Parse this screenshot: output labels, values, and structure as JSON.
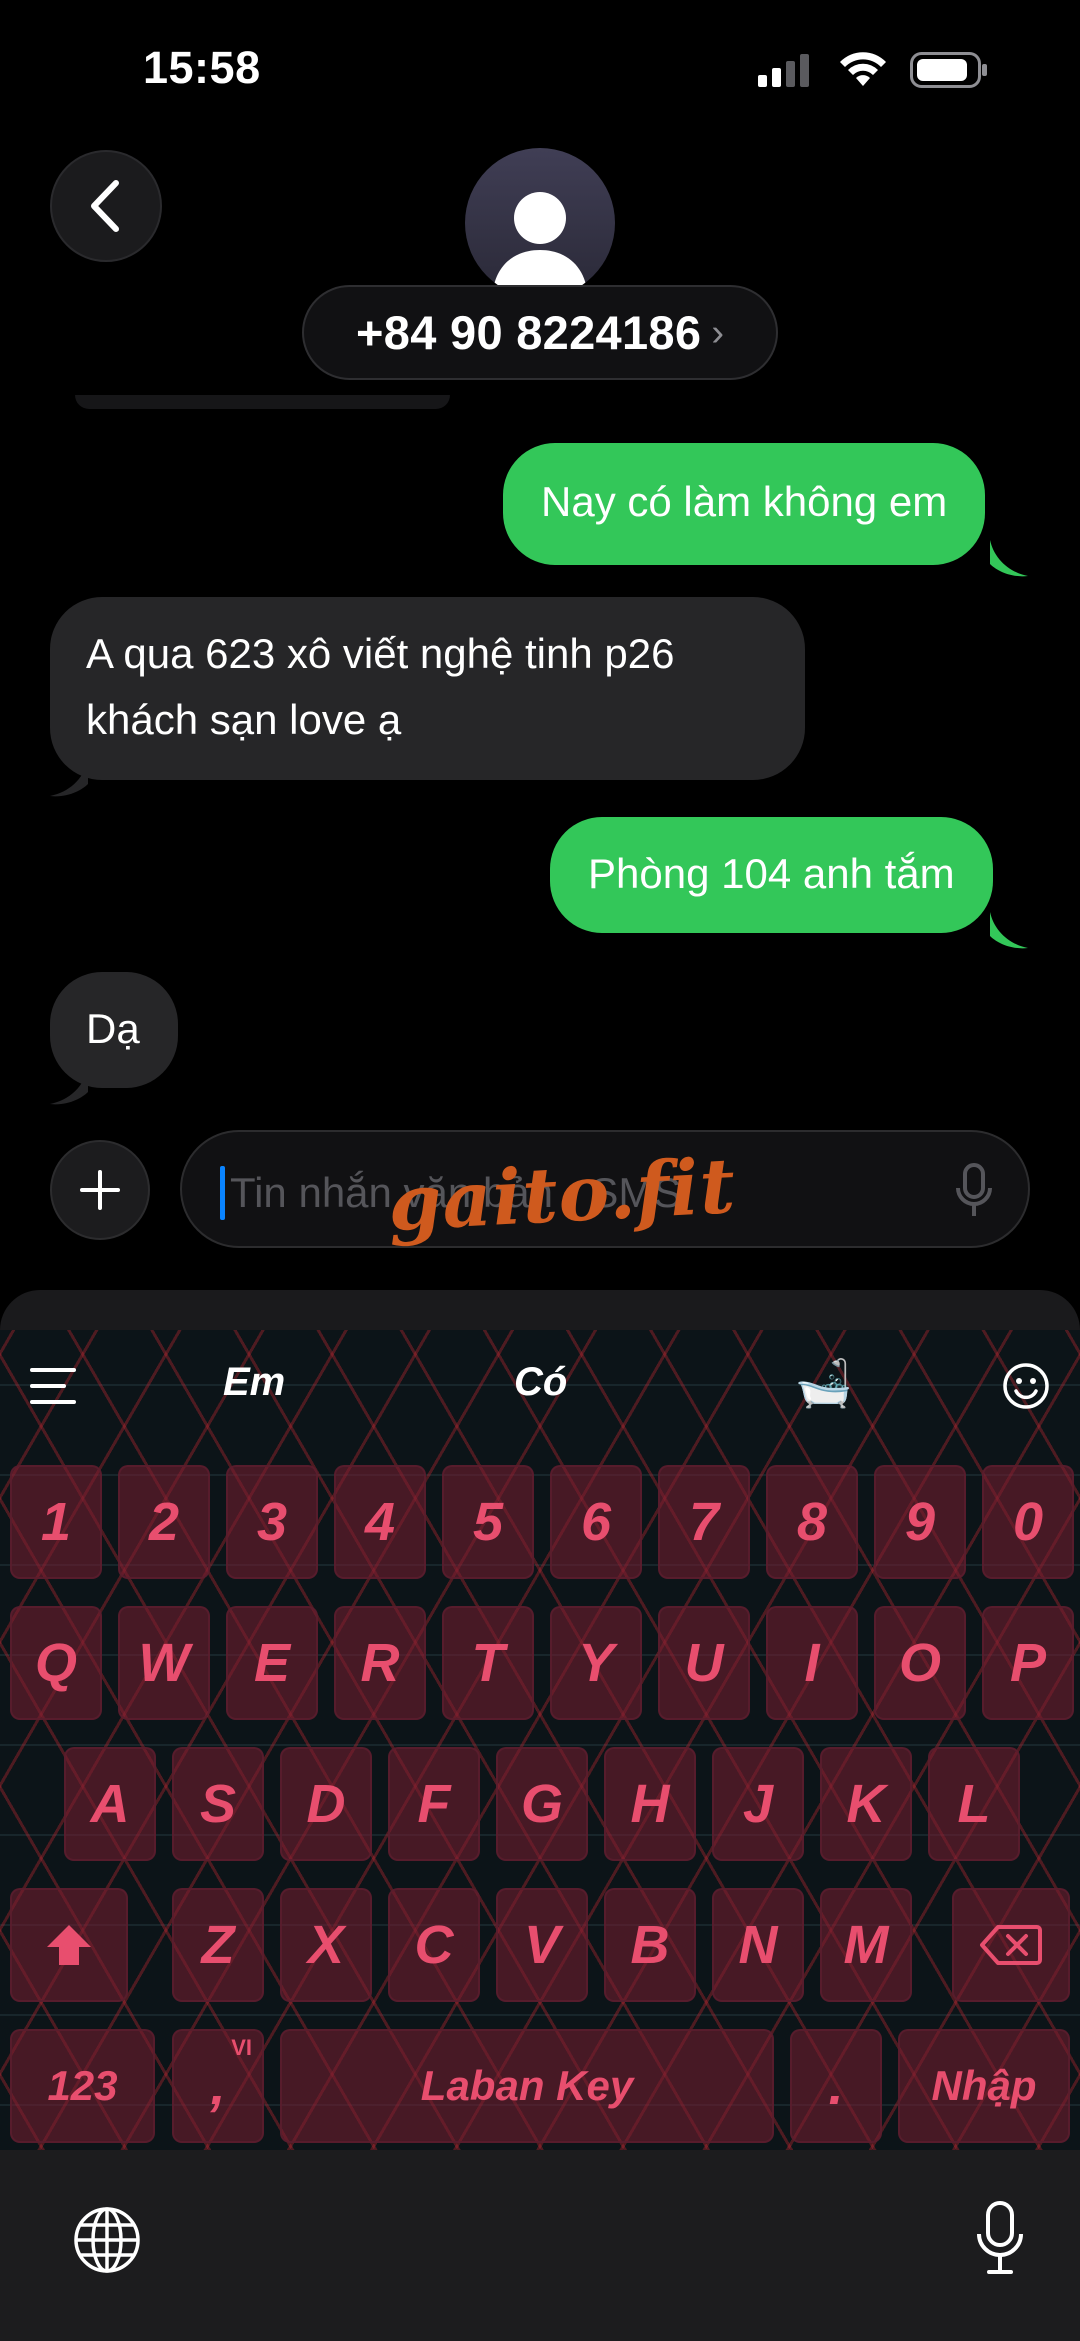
{
  "status_bar": {
    "time": "15:58"
  },
  "header": {
    "contact_number": "+84 90 8224186",
    "chevron": "›"
  },
  "messages": [
    {
      "type": "sent",
      "text": "Nay có làm không em"
    },
    {
      "type": "received",
      "line1": "A qua 623 xô viết nghệ tinh p26",
      "line2": "khách sạn love ạ"
    },
    {
      "type": "sent",
      "text": "Phòng 104 anh tắm"
    },
    {
      "type": "received",
      "text": "Dạ"
    }
  ],
  "input": {
    "placeholder": "Tin nhắn văn bản · SMS",
    "watermark": "gaito.fit"
  },
  "keyboard": {
    "suggestions": [
      "Em",
      "Có",
      "🛁"
    ],
    "row_numbers": [
      "1",
      "2",
      "3",
      "4",
      "5",
      "6",
      "7",
      "8",
      "9",
      "0"
    ],
    "row_q": [
      "Q",
      "W",
      "E",
      "R",
      "T",
      "Y",
      "U",
      "I",
      "O",
      "P"
    ],
    "row_a": [
      "A",
      "S",
      "D",
      "F",
      "G",
      "H",
      "J",
      "K",
      "L"
    ],
    "row_z": [
      "Z",
      "X",
      "C",
      "V",
      "B",
      "N",
      "M"
    ],
    "key_123": "123",
    "key_comma": ",",
    "key_comma_sup": "VI",
    "key_space": "Laban Key",
    "key_period": ".",
    "key_enter": "Nhập"
  },
  "icons": {
    "back": "chevron-left-icon",
    "avatar": "person-icon",
    "plus": "plus-icon",
    "mic": "microphone-icon",
    "globe": "globe-icon",
    "menu": "menu-icon",
    "smiley": "smiley-icon",
    "shift": "shift-icon",
    "delete": "backspace-icon"
  },
  "colors": {
    "sent_bubble": "#33c759",
    "received_bubble": "#262628",
    "key_text": "#e84e6e",
    "cursor": "#0a84ff"
  }
}
